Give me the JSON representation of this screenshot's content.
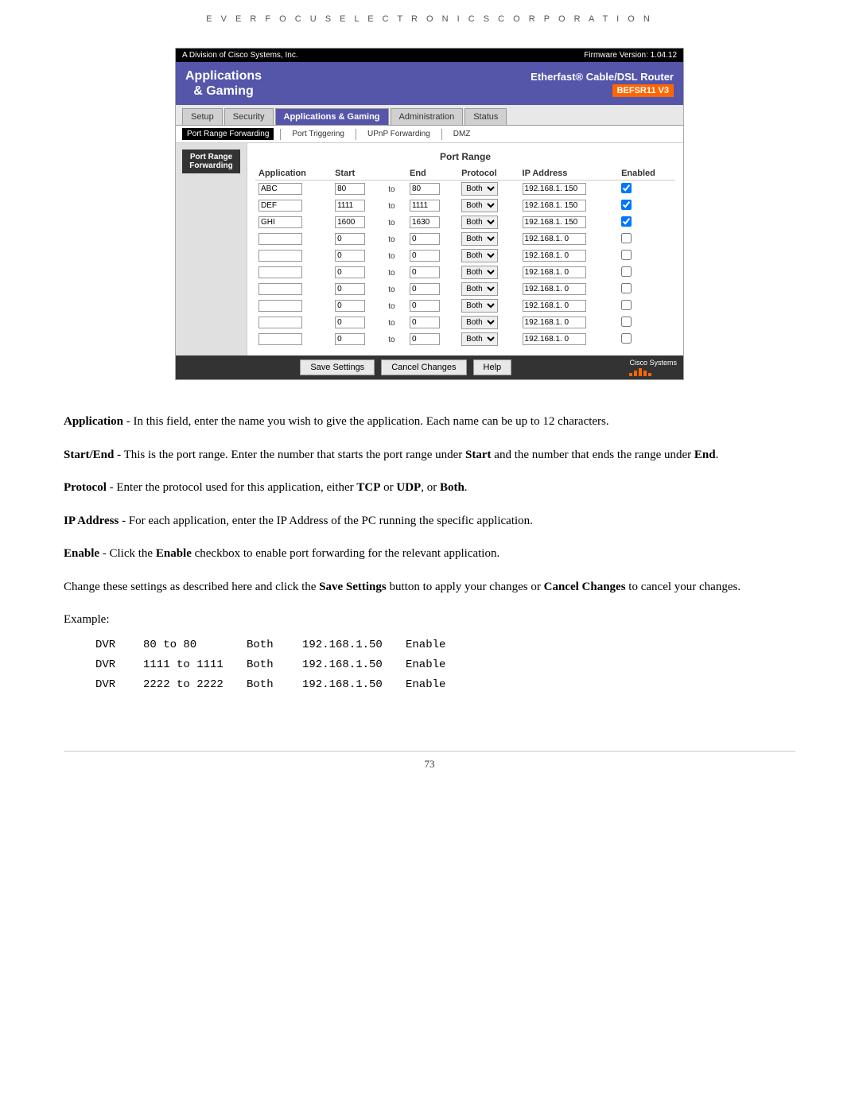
{
  "header": {
    "company": "E V E R F O C U S   E L E C T R O N I C S   C O R P O R A T I O N"
  },
  "router": {
    "top_bar": {
      "left": "A Division of Cisco Systems, Inc.",
      "right": "Firmware Version: 1.04.12"
    },
    "logo": {
      "text_line1": "Applications",
      "text_line2": "& Gaming",
      "product_name": "Etherfast® Cable/DSL Router",
      "model": "BEFSR11 V3"
    },
    "nav_tabs": [
      {
        "label": "Setup",
        "active": false
      },
      {
        "label": "Security",
        "active": false
      },
      {
        "label": "Applications & Gaming",
        "active": true
      },
      {
        "label": "Administration",
        "active": false
      },
      {
        "label": "Status",
        "active": false
      }
    ],
    "subnav_tabs": [
      {
        "label": "Port Range Forwarding",
        "active": true
      },
      {
        "label": "Port Triggering",
        "active": false
      },
      {
        "label": "UPnP Forwarding",
        "active": false
      },
      {
        "label": "DMZ",
        "active": false
      }
    ],
    "sidebar_label": "Port Range Forwarding",
    "table": {
      "section_title": "Port Range",
      "columns": [
        "Application",
        "Start",
        "",
        "End",
        "Protocol",
        "IP Address",
        "Enabled"
      ],
      "rows": [
        {
          "app": "ABC",
          "start": "80",
          "end": "80",
          "protocol": "Both",
          "ip": "192.168.1. 150",
          "enabled": true
        },
        {
          "app": "DEF",
          "start": "1111",
          "end": "1111",
          "protocol": "Both",
          "ip": "192.168.1. 150",
          "enabled": true
        },
        {
          "app": "GHI",
          "start": "1600",
          "end": "1630",
          "protocol": "Both",
          "ip": "192.168.1. 150",
          "enabled": true
        },
        {
          "app": "",
          "start": "0",
          "end": "0",
          "protocol": "Both",
          "ip": "192.168.1. 0",
          "enabled": false
        },
        {
          "app": "",
          "start": "0",
          "end": "0",
          "protocol": "Both",
          "ip": "192.168.1. 0",
          "enabled": false
        },
        {
          "app": "",
          "start": "0",
          "end": "0",
          "protocol": "Both",
          "ip": "192.168.1. 0",
          "enabled": false
        },
        {
          "app": "",
          "start": "0",
          "end": "0",
          "protocol": "Both",
          "ip": "192.168.1. 0",
          "enabled": false
        },
        {
          "app": "",
          "start": "0",
          "end": "0",
          "protocol": "Both",
          "ip": "192.168.1. 0",
          "enabled": false
        },
        {
          "app": "",
          "start": "0",
          "end": "0",
          "protocol": "Both",
          "ip": "192.168.1. 0",
          "enabled": false
        },
        {
          "app": "",
          "start": "0",
          "end": "0",
          "protocol": "Both",
          "ip": "192.168.1. 0",
          "enabled": false
        }
      ]
    },
    "buttons": {
      "save": "Save Settings",
      "cancel": "Cancel Changes",
      "help": "Help"
    },
    "cisco": {
      "label": "Cisco Systems"
    }
  },
  "doc": {
    "paragraphs": [
      {
        "label": "Application",
        "intro": " - In this field, enter the name you wish to give the application. Each name can be up to 12 characters."
      },
      {
        "label": "Start/End",
        "intro": " - This is the port range. Enter the number that starts the port range under ",
        "bold1": "Start",
        "mid": " and the number that ends the range under ",
        "bold2": "End",
        "end": "."
      },
      {
        "label": "Protocol",
        "intro": " - Enter the protocol used for this application, either ",
        "bold1": "TCP",
        "mid": " or ",
        "bold2": "UDP",
        "end": ", or ",
        "bold3": "Both",
        "final": "."
      },
      {
        "label": "IP Address",
        "intro": " - For each application, enter the IP Address of the PC running the specific application."
      },
      {
        "label": "Enable",
        "intro": " - Click the ",
        "bold1": "Enable",
        "end": " checkbox to enable port forwarding for the relevant application."
      },
      {
        "text": "Change these settings as described here and click the ",
        "bold1": "Save Settings",
        "mid": " button to apply your changes or ",
        "bold2": "Cancel Changes",
        "end": " to cancel your changes."
      }
    ],
    "example_label": "Example:",
    "example_rows": [
      {
        "col1": "DVR",
        "col2": "80 to 80",
        "col3": "Both",
        "col4": "192.168.1.50",
        "col5": "Enable"
      },
      {
        "col1": "DVR",
        "col2": "1111 to 1111",
        "col3": "Both",
        "col4": "192.168.1.50",
        "col5": "Enable"
      },
      {
        "col1": "DVR",
        "col2": "2222 to 2222",
        "col3": "Both",
        "col4": "192.168.1.50",
        "col5": "Enable"
      }
    ]
  },
  "footer": {
    "page_number": "73"
  }
}
